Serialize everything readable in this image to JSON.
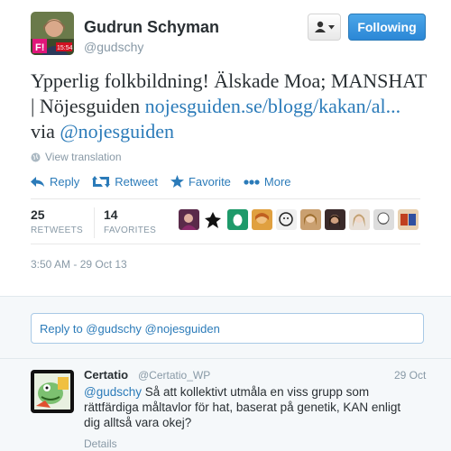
{
  "tweet": {
    "fullname": "Gudrun Schyman",
    "screenname": "@gudschy",
    "follow_label": "Following",
    "text_part1": "Ypperlig folkbildning! Älskade Moa; MANSHAT | Nöjesguiden ",
    "link_url": "nojesguiden.se/blogg/kakan/al...",
    "text_part2": " via ",
    "mention": "@nojesguiden",
    "translate_label": "View translation",
    "actions": {
      "reply": "Reply",
      "retweet": "Retweet",
      "favorite": "Favorite",
      "more": "More"
    },
    "stats": {
      "retweets_count": "25",
      "retweets_label": "RETWEETS",
      "favorites_count": "14",
      "favorites_label": "FAVORITES"
    },
    "timestamp": "3:50 AM - 29 Oct 13"
  },
  "reply_box": {
    "text": "Reply to @gudschy @nojesguiden"
  },
  "reply_tweet": {
    "name": "Certatio",
    "handle": "@Certatio_WP",
    "time": "29 Oct",
    "mention": "@gudschy",
    "text": " Så att kollektivt utmåla en viss grupp som rättfärdiga måltavlor för hat, baserat på genetik, KAN enligt dig alltså vara okej?",
    "details": "Details"
  },
  "colors": {
    "link": "#2b7bb9",
    "follow_button": "#2b87d6",
    "muted": "#8899a6",
    "reply_background": "#f5f8fa"
  }
}
